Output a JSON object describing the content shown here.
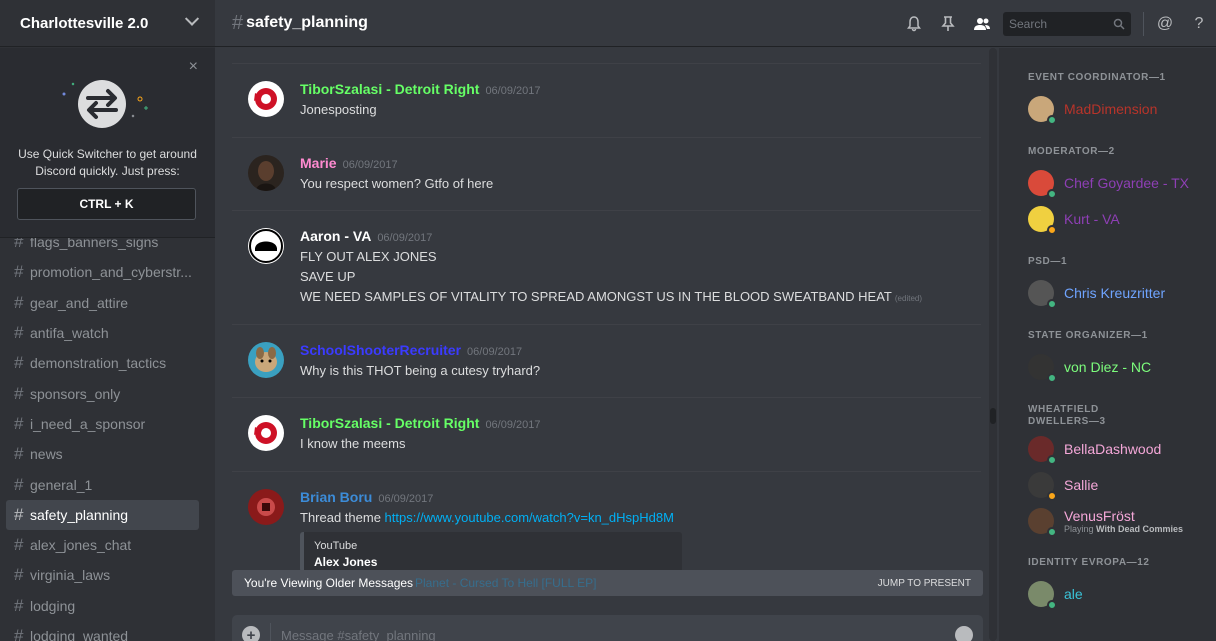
{
  "server": {
    "name": "Charlottesville 2.0"
  },
  "quick_switcher": {
    "message": "Use Quick Switcher to get around Discord quickly. Just press:",
    "shortcut": "CTRL + K",
    "close": "×"
  },
  "channels": [
    {
      "name": "flags_banners_signs",
      "active": false
    },
    {
      "name": "promotion_and_cyberstr...",
      "active": false
    },
    {
      "name": "gear_and_attire",
      "active": false
    },
    {
      "name": "antifa_watch",
      "active": false
    },
    {
      "name": "demonstration_tactics",
      "active": false
    },
    {
      "name": "sponsors_only",
      "active": false
    },
    {
      "name": "i_need_a_sponsor",
      "active": false
    },
    {
      "name": "news",
      "active": false
    },
    {
      "name": "general_1",
      "active": false
    },
    {
      "name": "safety_planning",
      "active": true
    },
    {
      "name": "alex_jones_chat",
      "active": false
    },
    {
      "name": "virginia_laws",
      "active": false
    },
    {
      "name": "lodging",
      "active": false
    },
    {
      "name": "lodging_wanted",
      "active": false
    }
  ],
  "topbar": {
    "hash": "#",
    "channel": "safety_planning",
    "search_placeholder": "Search",
    "icons": [
      "bell-icon",
      "pin-icon",
      "members-icon",
      "search-icon",
      "at-icon",
      "help-icon"
    ],
    "at": "@",
    "help": "?"
  },
  "messages": [
    {
      "author": "TiborSzalasi - Detroit Right",
      "color": "#66ff66",
      "time": "06/09/2017",
      "lines": [
        "Jonesposting"
      ],
      "avatar": "red-wings"
    },
    {
      "author": "Marie",
      "color": "#ff8ad0",
      "time": "06/09/2017",
      "lines": [
        "You respect women? Gtfo of here"
      ],
      "avatar": "dark"
    },
    {
      "author": "Aaron - VA",
      "color": "#ffffff",
      "time": "06/09/2017",
      "lines": [
        "FLY OUT ALEX JONES",
        "SAVE UP",
        "WE NEED SAMPLES OF VITALITY TO SPREAD AMONGST US IN THE BLOOD SWEATBAND HEAT"
      ],
      "edited": "(edited)",
      "avatar": "helmet"
    },
    {
      "author": "SchoolShooterRecruiter",
      "color": "#3b3bff",
      "time": "06/09/2017",
      "lines": [
        "Why is this THOT being a cutesy tryhard?"
      ],
      "avatar": "dog"
    },
    {
      "author": "TiborSzalasi - Detroit Right",
      "color": "#66ff66",
      "time": "06/09/2017",
      "lines": [
        "I know the meems"
      ],
      "avatar": "red-wings"
    },
    {
      "author": "Brian Boru",
      "color": "#3c8cd8",
      "time": "06/09/2017",
      "prefix": "Thread theme ",
      "link": "https://www.youtube.com/watch?v=kn_dHspHd8M",
      "embed": {
        "provider": "YouTube",
        "title": "Alex Jones"
      },
      "avatar": "flag"
    }
  ],
  "older_bar": {
    "text": "You're Viewing Older Messages",
    "behind": "Planet - Cursed To Hell [FULL EP]",
    "jump": "JUMP TO PRESENT"
  },
  "composer": {
    "placeholder": "Message #safety_planning"
  },
  "member_list": [
    {
      "role": "EVENT COORDINATOR—1",
      "members": [
        {
          "name": "MadDimension",
          "color": "#b8342a",
          "status": "online"
        }
      ]
    },
    {
      "role": "MODERATOR—2",
      "members": [
        {
          "name": "Chef Goyardee - TX",
          "color": "#8e3fb5",
          "status": "online"
        },
        {
          "name": "Kurt - VA",
          "color": "#8e3fb5",
          "status": "idle"
        }
      ]
    },
    {
      "role": "PSD—1",
      "members": [
        {
          "name": "Chris Kreuzritter",
          "color": "#6fa4ff",
          "status": "online"
        }
      ]
    },
    {
      "role": "STATE ORGANIZER—1",
      "members": [
        {
          "name": "von Diez - NC",
          "color": "#7cfc7c",
          "status": "online"
        }
      ]
    },
    {
      "role": "WHEATFIELD DWELLERS—3",
      "members": [
        {
          "name": "BellaDashwood",
          "color": "#f4a7d8",
          "status": "online"
        },
        {
          "name": "Sallie",
          "color": "#f4a7d8",
          "status": "idle"
        },
        {
          "name": "VenusFröst",
          "color": "#f4a7d8",
          "status": "online",
          "activity_prefix": "Playing ",
          "activity": "With Dead Commies"
        }
      ]
    },
    {
      "role": "IDENTITY EVROPA—12",
      "members": [
        {
          "name": "ale",
          "color": "#3ac3d8",
          "status": "online"
        }
      ]
    }
  ],
  "colors": {
    "accent": "#7289da",
    "online": "#43b581",
    "idle": "#faa61a",
    "link": "#00b0f4"
  }
}
